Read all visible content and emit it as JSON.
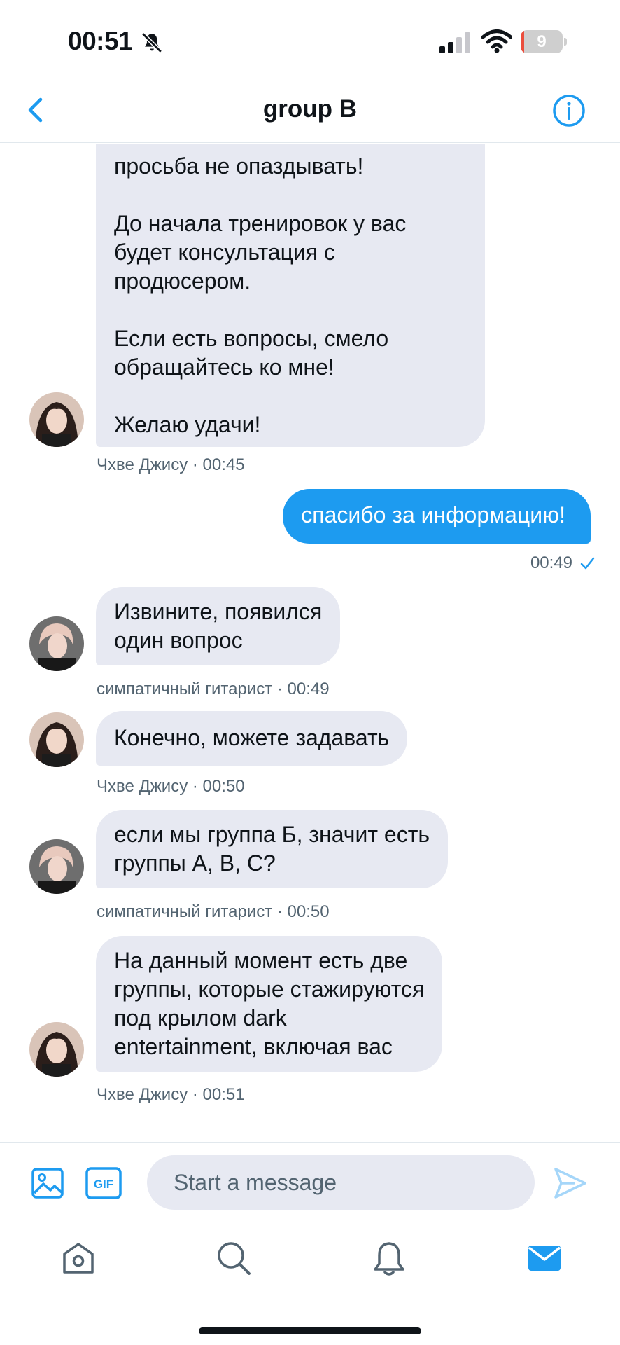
{
  "status_bar": {
    "time": "00:51",
    "battery_level": "9",
    "battery_fraction": 0.09,
    "bell_icon": "bell-slash-icon",
    "signal_icon": "cellular-signal-icon",
    "wifi_icon": "wifi-icon"
  },
  "header": {
    "title": "group B",
    "back_icon": "chevron-left-icon",
    "info_icon": "info-circle-icon"
  },
  "colors": {
    "accent": "#1d9bf0",
    "incoming_bubble": "#e7e9f2",
    "meta_text": "#536471",
    "battery_low": "#eb4e3d"
  },
  "messages": [
    {
      "direction": "in",
      "text": "просьба не опаздывать!\n\nДо начала тренировок у вас будет консультация с продюсером.\n\nЕсли есть вопросы, смело обращайтесь ко мне!\n\nЖелаю удачи!",
      "sender": "Чхве Джису",
      "meta": "Чхве Джису · 00:45",
      "avatar": "avatar-jisoo"
    },
    {
      "direction": "out",
      "text": "спасибо за информацию!",
      "meta": "00:49",
      "status_icon": "checkmark-icon"
    },
    {
      "direction": "in",
      "text": "Извините, появился\nодин вопрос",
      "sender": "симпатичный гитарист",
      "meta": "симпатичный гитарист · 00:49",
      "avatar": "avatar-guitarist"
    },
    {
      "direction": "in",
      "text": "Конечно, можете задавать",
      "sender": "Чхве Джису",
      "meta": "Чхве Джису · 00:50",
      "avatar": "avatar-jisoo"
    },
    {
      "direction": "in",
      "text": "если мы группа Б, значит есть\nгруппы А, В, С?",
      "sender": "симпатичный гитарист",
      "meta": "симпатичный гитарист · 00:50",
      "avatar": "avatar-guitarist"
    },
    {
      "direction": "in",
      "text": "На данный момент есть две\nгруппы, которые стажируются\nпод крылом dark\nentertainment, включая вас",
      "sender": "Чхве Джису",
      "meta": "Чхве Джису · 00:51",
      "avatar": "avatar-jisoo"
    }
  ],
  "composer": {
    "placeholder": "Start a message",
    "media_icon": "image-icon",
    "gif_label": "GIF",
    "send_icon": "send-icon"
  },
  "tabbar": {
    "items": [
      {
        "name": "home",
        "icon": "home-icon",
        "active": false
      },
      {
        "name": "search",
        "icon": "search-icon",
        "active": false
      },
      {
        "name": "notifications",
        "icon": "bell-icon",
        "active": false
      },
      {
        "name": "messages",
        "icon": "mail-icon",
        "active": true
      }
    ]
  }
}
